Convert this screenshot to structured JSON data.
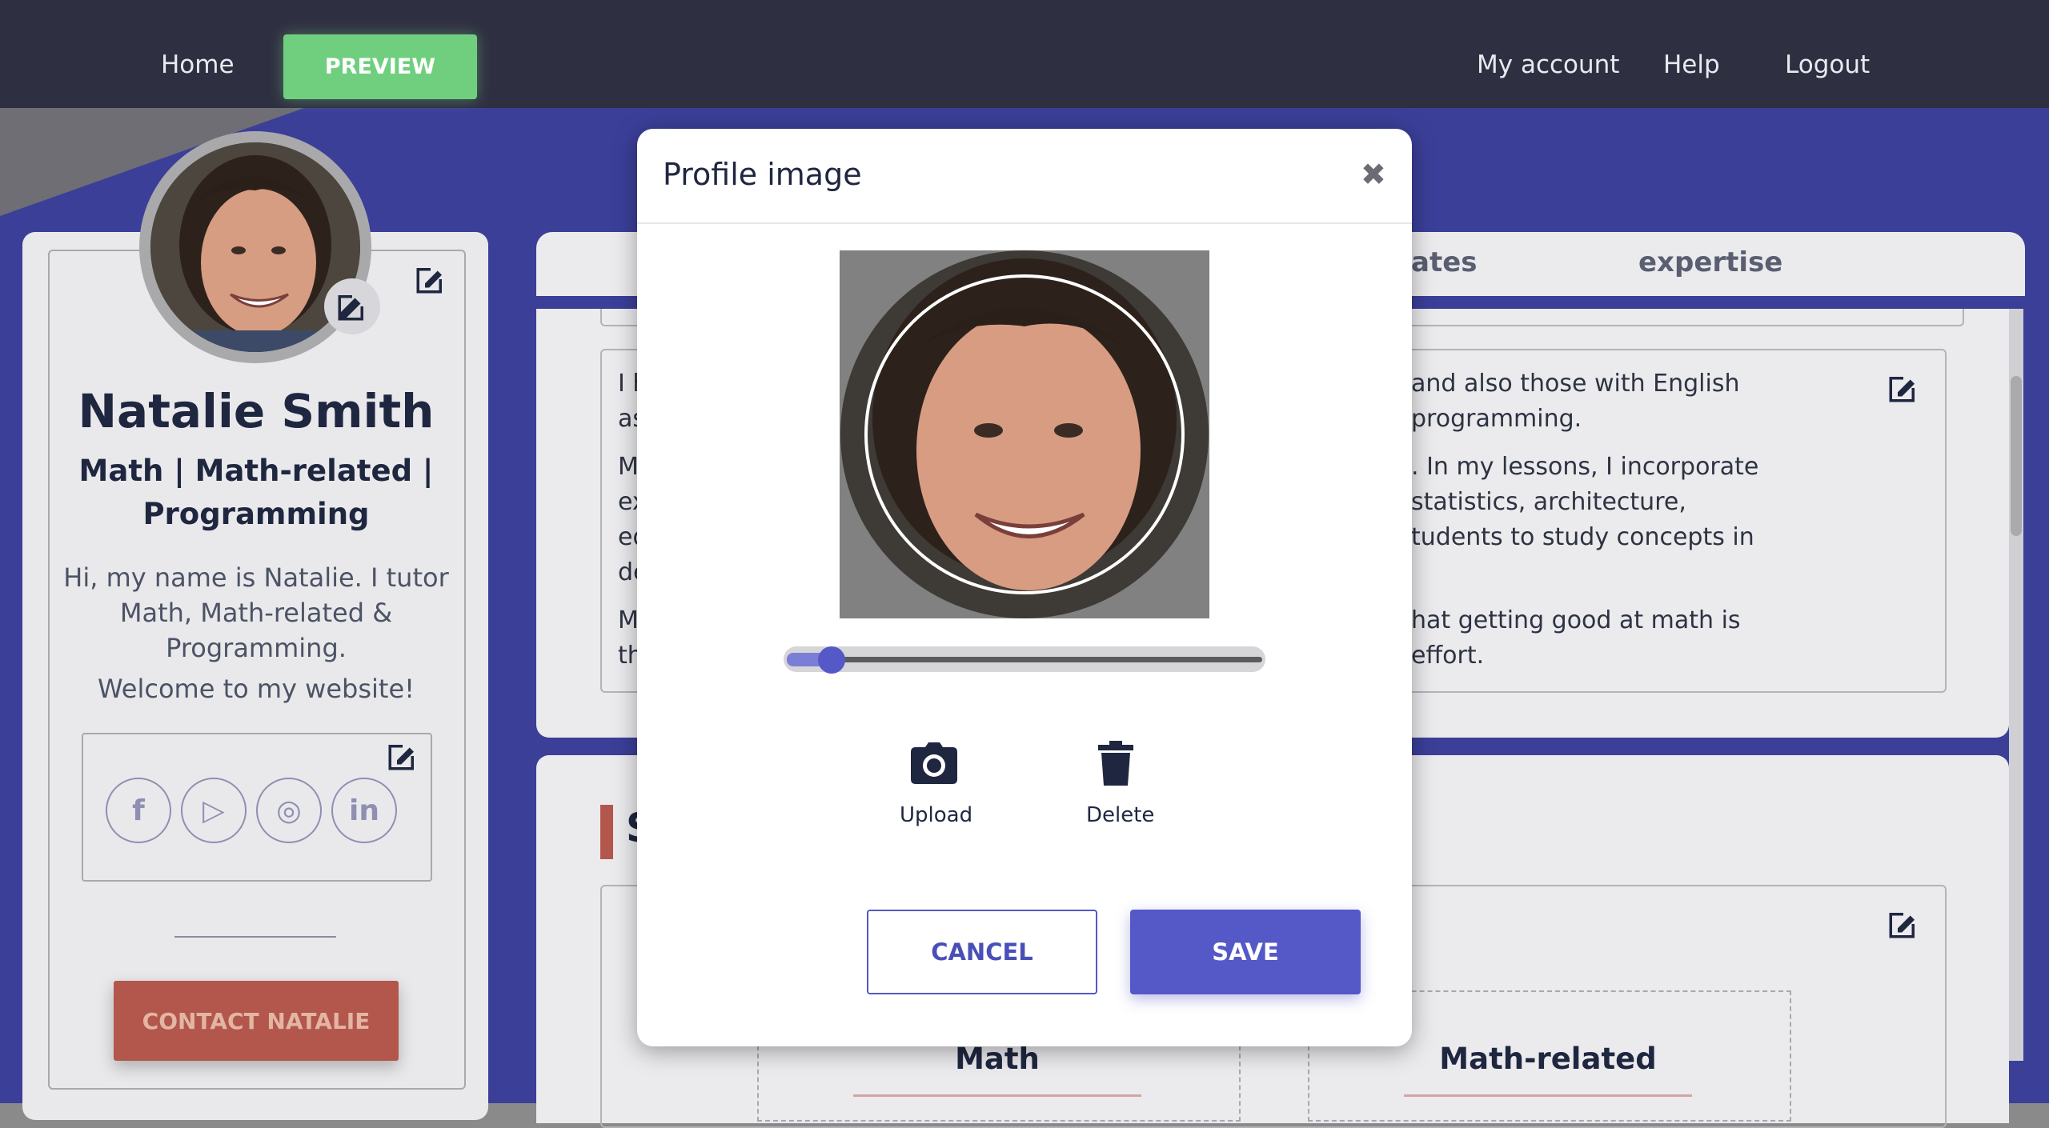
{
  "nav": {
    "home": "Home",
    "preview": "PREVIEW",
    "my_account": "My account",
    "help": "Help",
    "logout": "Logout"
  },
  "profile": {
    "name": "Natalie Smith",
    "subjects": "Math | Math-related | Programming",
    "bio": "Hi, my name is Natalie. I tutor Math, Math-related & Programming.",
    "welcome": "Welcome to my website!",
    "contact_button": "CONTACT NATALIE"
  },
  "tabs": {
    "visible_partial": "ates",
    "expertise": "expertise"
  },
  "about_fragments": {
    "line1": "and also those with English",
    "line2": "programming.",
    "line3": ". In my lessons, I incorporate",
    "line4": "statistics, architecture,",
    "line5": "tudents to study concepts in",
    "line6": "hat getting good at math is",
    "line7": "effort.",
    "left1": "I h",
    "left2": "as",
    "left3": "M",
    "left4": "ex",
    "left5": "ed",
    "left6": "de",
    "left7": "M",
    "left8": "th"
  },
  "skills": {
    "heading_partial": "S",
    "cards": [
      "Math",
      "Math-related"
    ]
  },
  "modal": {
    "title": "Profile image",
    "close": "✖",
    "zoom_level": 0.06,
    "upload_label": "Upload",
    "delete_label": "Delete",
    "cancel_label": "CANCEL",
    "save_label": "SAVE"
  },
  "colors": {
    "nav_bg": "#2f2f42",
    "preview_green": "#6fcf7e",
    "primary": "#5558c7",
    "contact_red": "#b3564c",
    "background_blue": "#3b3f98"
  },
  "icons": [
    "edit-icon",
    "facebook-icon",
    "youtube-icon",
    "instagram-icon",
    "linkedin-icon",
    "camera-icon",
    "trash-icon",
    "close-icon"
  ]
}
